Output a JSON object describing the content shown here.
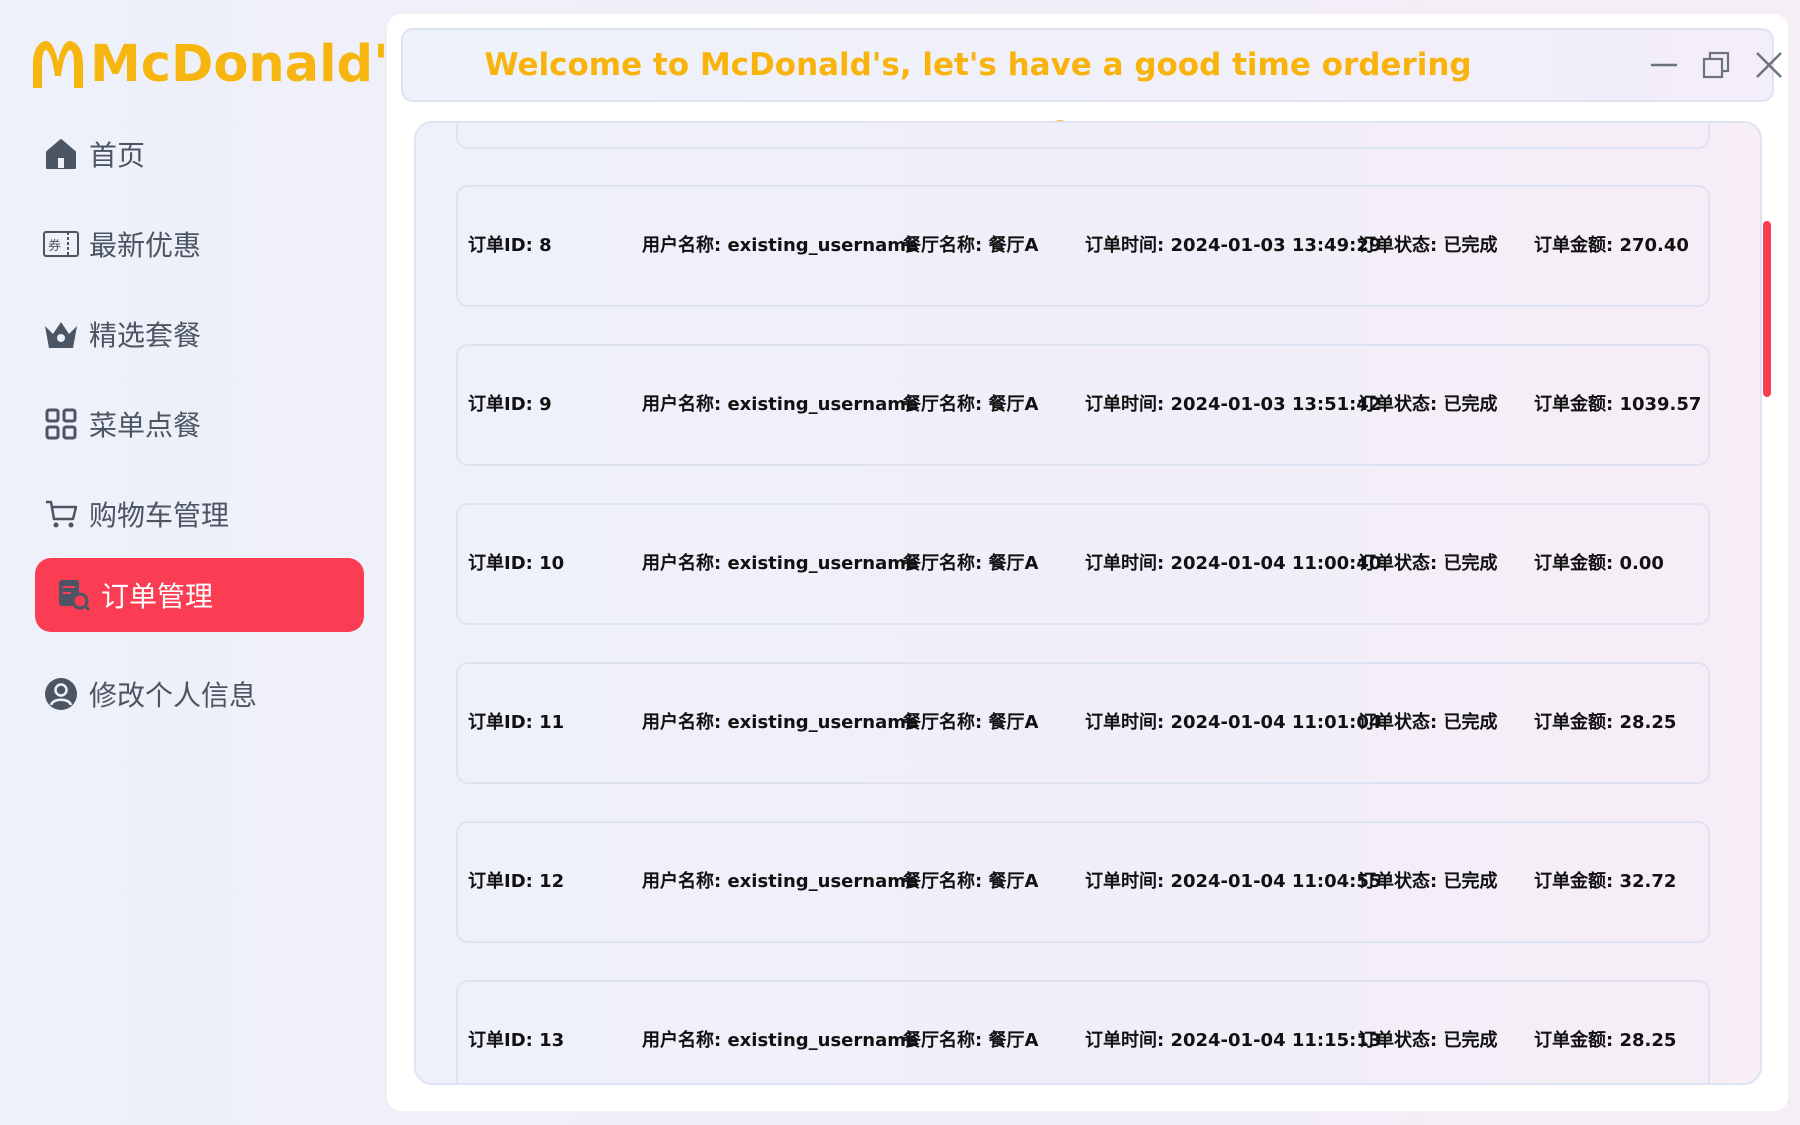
{
  "brand": {
    "name": "McDonald's"
  },
  "sidebar": {
    "items": [
      {
        "label": "首页",
        "icon": "home-icon",
        "active": false
      },
      {
        "label": "最新优惠",
        "icon": "coupon-icon",
        "active": false
      },
      {
        "label": "精选套餐",
        "icon": "crown-basket-icon",
        "active": false
      },
      {
        "label": "菜单点餐",
        "icon": "grid-icon",
        "active": false
      },
      {
        "label": "购物车管理",
        "icon": "cart-icon",
        "active": false
      },
      {
        "label": "订单管理",
        "icon": "order-search-icon",
        "active": true
      },
      {
        "label": "修改个人信息",
        "icon": "user-icon",
        "active": false
      }
    ]
  },
  "header": {
    "welcome": "Welcome to McDonald's, let's have a good time ordering together 😊"
  },
  "orders": [
    {
      "id": "订单ID: 8",
      "user": "用户名称: existing_username",
      "restaurant": "餐厅名称: 餐厅A",
      "time": "订单时间: 2024-01-03 13:49:29",
      "status": "订单状态: 已完成",
      "amount": "订单金额: 270.40"
    },
    {
      "id": "订单ID: 9",
      "user": "用户名称: existing_username",
      "restaurant": "餐厅名称: 餐厅A",
      "time": "订单时间: 2024-01-03 13:51:42",
      "status": "订单状态: 已完成",
      "amount": "订单金额: 1039.57"
    },
    {
      "id": "订单ID: 10",
      "user": "用户名称: existing_username",
      "restaurant": "餐厅名称: 餐厅A",
      "time": "订单时间: 2024-01-04 11:00:40",
      "status": "订单状态: 已完成",
      "amount": "订单金额: 0.00"
    },
    {
      "id": "订单ID: 11",
      "user": "用户名称: existing_username",
      "restaurant": "餐厅名称: 餐厅A",
      "time": "订单时间: 2024-01-04 11:01:04",
      "status": "订单状态: 已完成",
      "amount": "订单金额: 28.25"
    },
    {
      "id": "订单ID: 12",
      "user": "用户名称: existing_username",
      "restaurant": "餐厅名称: 餐厅A",
      "time": "订单时间: 2024-01-04 11:04:55",
      "status": "订单状态: 已完成",
      "amount": "订单金额: 32.72"
    },
    {
      "id": "订单ID: 13",
      "user": "用户名称: existing_username",
      "restaurant": "餐厅名称: 餐厅A",
      "time": "订单时间: 2024-01-04 11:15:13",
      "status": "订单状态: 已完成",
      "amount": "订单金额: 28.25"
    }
  ],
  "colors": {
    "accent": "#fb3d53",
    "brand_yellow": "#f7b60f",
    "sidebar_text": "#4c5563"
  }
}
